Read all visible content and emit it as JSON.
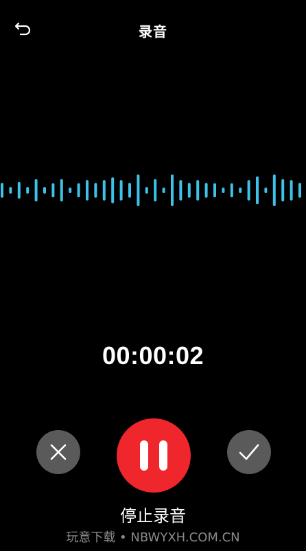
{
  "header": {
    "title": "录音",
    "back_icon": "undo-arrow-icon"
  },
  "waveform": {
    "color": "#3ec2e8",
    "bars": [
      0.4,
      0.18,
      0.45,
      0.18,
      0.6,
      0.18,
      0.38,
      0.6,
      0.15,
      0.38,
      0.55,
      0.4,
      0.55,
      0.7,
      0.55,
      0.4,
      0.85,
      0.18,
      0.6,
      0.15,
      0.85,
      0.55,
      0.4,
      0.55,
      0.4,
      0.38,
      0.15,
      0.38,
      0.15,
      0.55,
      0.75,
      0.15,
      0.85,
      0.6,
      0.55,
      0.4,
      0.15,
      0.18,
      0.15,
      0.4,
      0.55,
      0.18,
      0.4,
      0.4,
      0.15,
      0.38,
      0.18,
      0.55,
      0.15,
      0.38,
      0.55,
      0.4,
      0.38,
      0.55,
      0.4,
      0.4,
      0.15,
      0.4,
      0.18,
      0.55
    ]
  },
  "timer": {
    "value": "00:00:02"
  },
  "controls": {
    "cancel_icon": "close-icon",
    "pause_icon": "pause-icon",
    "confirm_icon": "check-icon",
    "cancel_color": "#5a5a5a",
    "record_color": "#f0262d",
    "stop_label": "停止录音"
  },
  "watermark": {
    "text": "玩意下载 • NBWYXH.COM.CN"
  }
}
